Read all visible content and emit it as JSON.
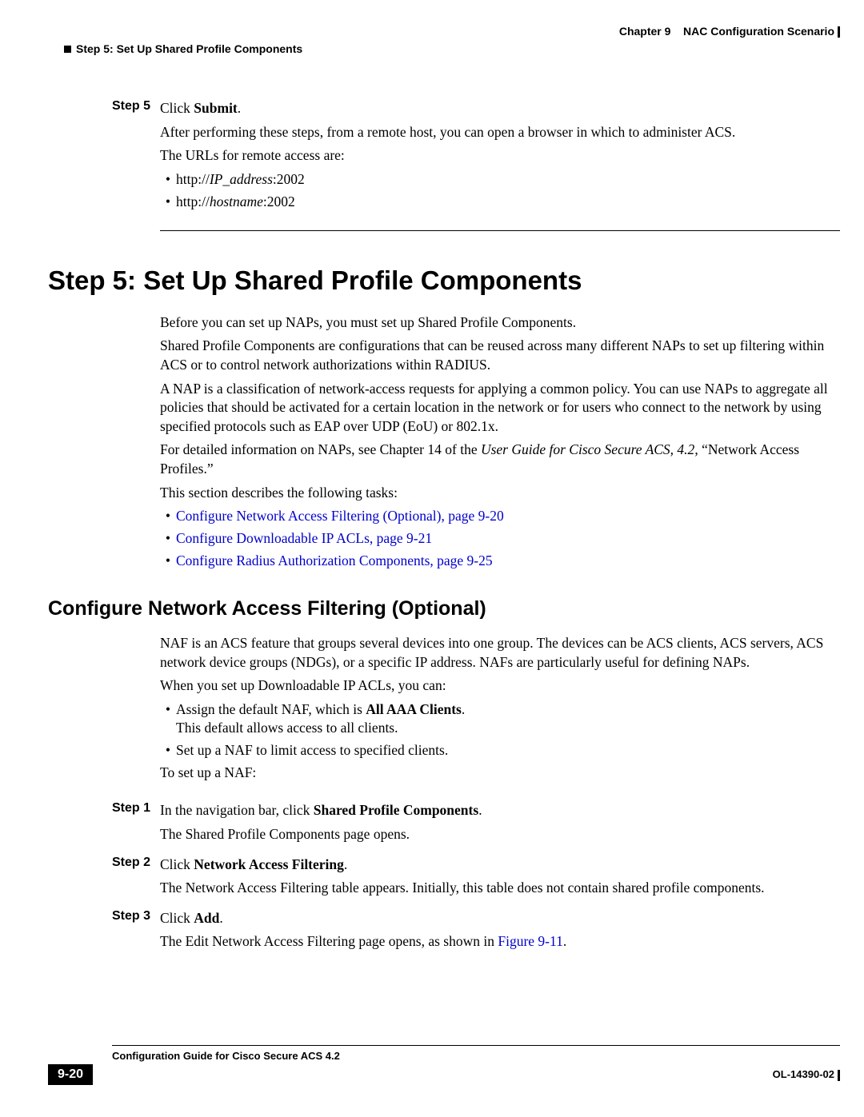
{
  "header": {
    "chapter": "Chapter 9    NAC Configuration Scenario",
    "section": "Step 5: Set Up Shared Profile Components"
  },
  "topSteps": {
    "step5": {
      "label": "Step 5",
      "line1_prefix": "Click ",
      "line1_bold": "Submit",
      "line1_suffix": ".",
      "line2": "After performing these steps, from a remote host, you can open a browser in which to administer ACS.",
      "line3": "The URLs for remote access are:",
      "bullet1_pre": "http://",
      "bullet1_it": "IP_address",
      "bullet1_post": ":2002",
      "bullet2_pre": "http://",
      "bullet2_it": "hostname",
      "bullet2_post": ":2002"
    }
  },
  "h1": "Step 5: Set Up Shared Profile Components",
  "intro": {
    "p1": "Before you can set up NAPs, you must set up Shared Profile Components.",
    "p2": "Shared Profile Components are configurations that can be reused across many different NAPs to set up filtering within ACS or to control network authorizations within RADIUS.",
    "p3": "A NAP is a classification of network-access requests for applying a common policy. You can use NAPs to aggregate all policies that should be activated for a certain location in the network or for users who connect to the network by using specified protocols such as EAP over UDP (EoU) or 802.1x.",
    "p4_pre": "For detailed information on NAPs, see Chapter 14 of the ",
    "p4_it": "User Guide for Cisco Secure ACS, 4.2",
    "p4_post": ", “Network Access Profiles.”",
    "p5": "This section describes the following tasks:",
    "link1": "Configure Network Access Filtering (Optional), page 9-20",
    "link2": "Configure Downloadable IP ACLs, page 9-21",
    "link3": "Configure Radius Authorization Components, page 9-25"
  },
  "h2": "Configure Network Access Filtering (Optional)",
  "naf": {
    "p1": "NAF is an ACS feature that groups several devices into one group. The devices can be ACS clients, ACS servers, ACS network device groups (NDGs), or a specific IP address. NAFs are particularly useful for defining NAPs.",
    "p2": "When you set up Downloadable IP ACLs, you can:",
    "b1_pre": "Assign the default NAF, which is ",
    "b1_bold": "All AAA Clients",
    "b1_post": ".",
    "b1_line2": "This default allows access to all clients.",
    "b2": "Set up a NAF to limit access to specified clients.",
    "p3": "To set up a NAF:"
  },
  "steps2": {
    "s1": {
      "label": "Step 1",
      "l1_pre": "In the navigation bar, click ",
      "l1_bold": "Shared Profile Components",
      "l1_post": ".",
      "l2": "The Shared Profile Components page opens."
    },
    "s2": {
      "label": "Step 2",
      "l1_pre": "Click ",
      "l1_bold": "Network Access Filtering",
      "l1_post": ".",
      "l2": "The Network Access Filtering table appears. Initially, this table does not contain shared profile components."
    },
    "s3": {
      "label": "Step 3",
      "l1_pre": "Click ",
      "l1_bold": "Add",
      "l1_post": ".",
      "l2_pre": "The Edit Network Access Filtering page opens, as shown in ",
      "l2_link": "Figure 9-11",
      "l2_post": "."
    }
  },
  "footer": {
    "guide": "Configuration Guide for Cisco Secure ACS 4.2",
    "page": "9-20",
    "doc": "OL-14390-02"
  }
}
